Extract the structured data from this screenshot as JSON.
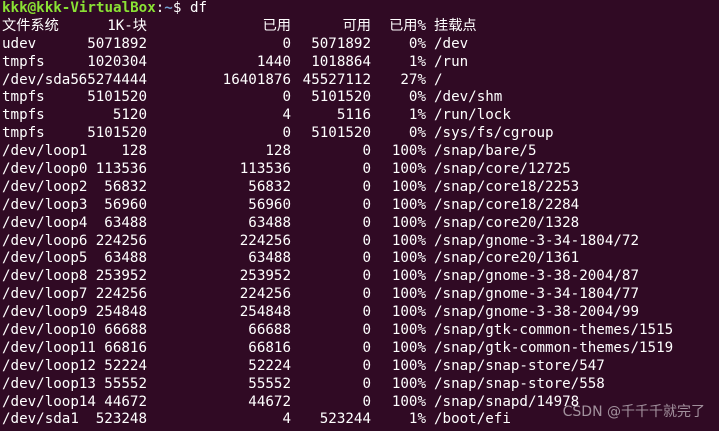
{
  "prompt": {
    "user_host": "kkk@kkk-VirtualBox",
    "sep": ":",
    "path": "~",
    "symbol": "$",
    "command": "df"
  },
  "header": {
    "filesystem": "文件系统",
    "blocks": "1K-块",
    "used": "已用",
    "available": "可用",
    "use_pct": "已用%",
    "mounted_on": "挂载点"
  },
  "rows": [
    {
      "fs": "udev",
      "blocks": "5071892",
      "used": "0",
      "avail": "5071892",
      "pct": "0%",
      "mount": "/dev"
    },
    {
      "fs": "tmpfs",
      "blocks": "1020304",
      "used": "1440",
      "avail": "1018864",
      "pct": "1%",
      "mount": "/run"
    },
    {
      "fs": "/dev/sda5",
      "blocks": "65274444",
      "used": "16401876",
      "avail": "45527112",
      "pct": "27%",
      "mount": "/"
    },
    {
      "fs": "tmpfs",
      "blocks": "5101520",
      "used": "0",
      "avail": "5101520",
      "pct": "0%",
      "mount": "/dev/shm"
    },
    {
      "fs": "tmpfs",
      "blocks": "5120",
      "used": "4",
      "avail": "5116",
      "pct": "1%",
      "mount": "/run/lock"
    },
    {
      "fs": "tmpfs",
      "blocks": "5101520",
      "used": "0",
      "avail": "5101520",
      "pct": "0%",
      "mount": "/sys/fs/cgroup"
    },
    {
      "fs": "/dev/loop1",
      "blocks": "128",
      "used": "128",
      "avail": "0",
      "pct": "100%",
      "mount": "/snap/bare/5"
    },
    {
      "fs": "/dev/loop0",
      "blocks": "113536",
      "used": "113536",
      "avail": "0",
      "pct": "100%",
      "mount": "/snap/core/12725"
    },
    {
      "fs": "/dev/loop2",
      "blocks": "56832",
      "used": "56832",
      "avail": "0",
      "pct": "100%",
      "mount": "/snap/core18/2253"
    },
    {
      "fs": "/dev/loop3",
      "blocks": "56960",
      "used": "56960",
      "avail": "0",
      "pct": "100%",
      "mount": "/snap/core18/2284"
    },
    {
      "fs": "/dev/loop4",
      "blocks": "63488",
      "used": "63488",
      "avail": "0",
      "pct": "100%",
      "mount": "/snap/core20/1328"
    },
    {
      "fs": "/dev/loop6",
      "blocks": "224256",
      "used": "224256",
      "avail": "0",
      "pct": "100%",
      "mount": "/snap/gnome-3-34-1804/72"
    },
    {
      "fs": "/dev/loop5",
      "blocks": "63488",
      "used": "63488",
      "avail": "0",
      "pct": "100%",
      "mount": "/snap/core20/1361"
    },
    {
      "fs": "/dev/loop8",
      "blocks": "253952",
      "used": "253952",
      "avail": "0",
      "pct": "100%",
      "mount": "/snap/gnome-3-38-2004/87"
    },
    {
      "fs": "/dev/loop7",
      "blocks": "224256",
      "used": "224256",
      "avail": "0",
      "pct": "100%",
      "mount": "/snap/gnome-3-34-1804/77"
    },
    {
      "fs": "/dev/loop9",
      "blocks": "254848",
      "used": "254848",
      "avail": "0",
      "pct": "100%",
      "mount": "/snap/gnome-3-38-2004/99"
    },
    {
      "fs": "/dev/loop10",
      "blocks": "66688",
      "used": "66688",
      "avail": "0",
      "pct": "100%",
      "mount": "/snap/gtk-common-themes/1515"
    },
    {
      "fs": "/dev/loop11",
      "blocks": "66816",
      "used": "66816",
      "avail": "0",
      "pct": "100%",
      "mount": "/snap/gtk-common-themes/1519"
    },
    {
      "fs": "/dev/loop12",
      "blocks": "52224",
      "used": "52224",
      "avail": "0",
      "pct": "100%",
      "mount": "/snap/snap-store/547"
    },
    {
      "fs": "/dev/loop13",
      "blocks": "55552",
      "used": "55552",
      "avail": "0",
      "pct": "100%",
      "mount": "/snap/snap-store/558"
    },
    {
      "fs": "/dev/loop14",
      "blocks": "44672",
      "used": "44672",
      "avail": "0",
      "pct": "100%",
      "mount": "/snap/snapd/14978"
    },
    {
      "fs": "/dev/sda1",
      "blocks": "523248",
      "used": "4",
      "avail": "523244",
      "pct": "1%",
      "mount": "/boot/efi"
    }
  ],
  "watermark": "CSDN @千千千就完了",
  "colors": {
    "background": "#300a24",
    "prompt_user": "#8ae234",
    "prompt_path": "#729fcf",
    "text": "#ffffff"
  }
}
